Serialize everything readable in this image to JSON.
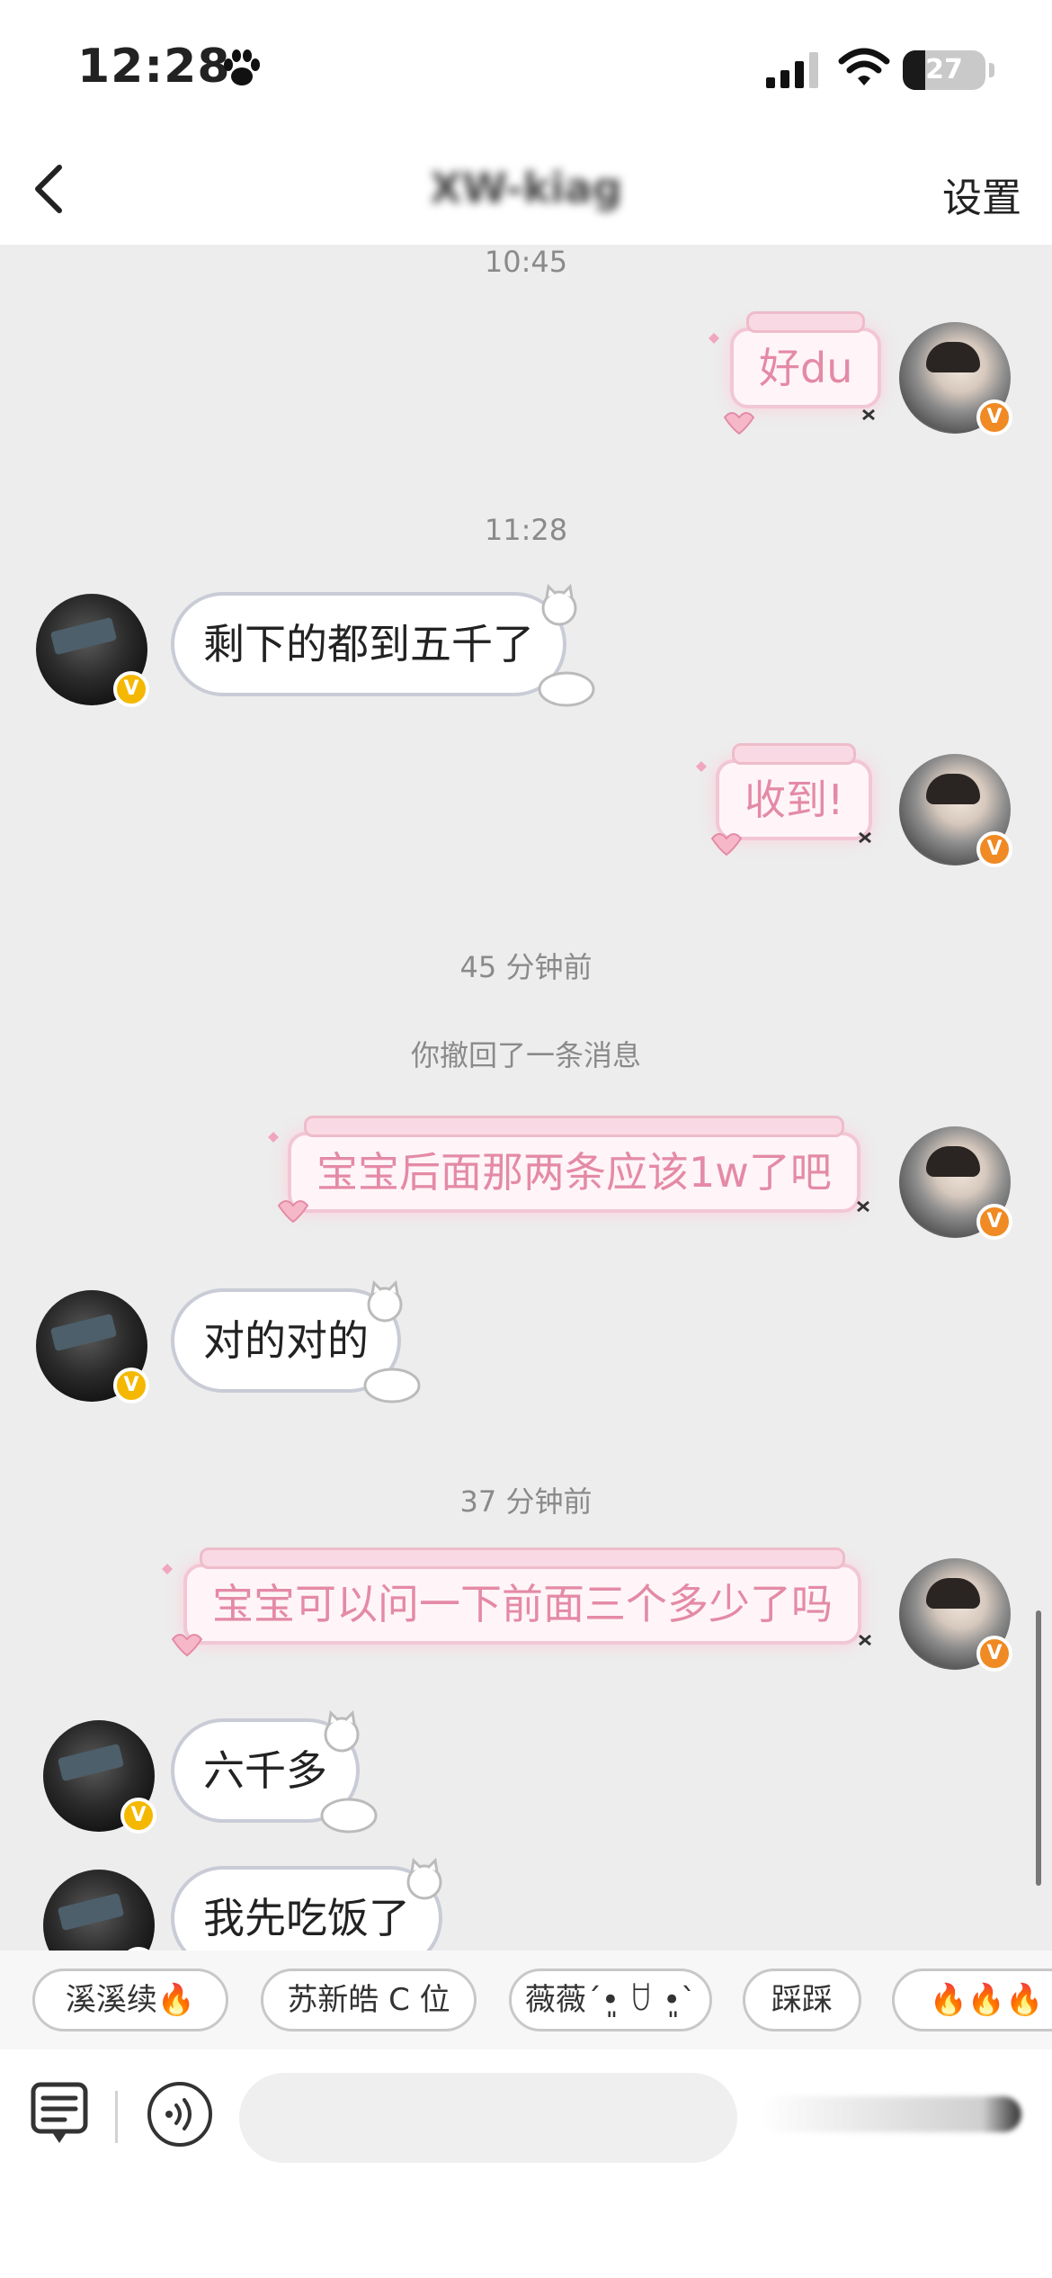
{
  "status_bar": {
    "time": "12:28",
    "battery": "27",
    "battery_level": 0.27
  },
  "nav": {
    "title": "XW-kiag",
    "settings_label": "设置"
  },
  "messages": [
    {
      "type": "timestamp",
      "text": "10:45"
    },
    {
      "type": "sent",
      "text": "好du"
    },
    {
      "type": "timestamp",
      "text": "11:28"
    },
    {
      "type": "received",
      "text": "剩下的都到五千了"
    },
    {
      "type": "sent",
      "text": "收到!"
    },
    {
      "type": "timestamp",
      "text": "45 分钟前"
    },
    {
      "type": "system",
      "text": "你撤回了一条消息"
    },
    {
      "type": "sent",
      "text": "宝宝后面那两条应该1w了吧"
    },
    {
      "type": "received",
      "text": "对的对的"
    },
    {
      "type": "timestamp",
      "text": "37 分钟前"
    },
    {
      "type": "sent",
      "text": "宝宝可以问一下前面三个多少了吗"
    },
    {
      "type": "received",
      "text": "六千多"
    },
    {
      "type": "received",
      "text": "我先吃饭了"
    }
  ],
  "quick_replies": [
    "溪溪续🔥",
    "苏新皓 C 位",
    "薇薇ˊ•͈ ꇴ •͈ˋ",
    "踩踩",
    "🔥🔥🔥"
  ],
  "badges": {
    "verified": "V"
  },
  "colors": {
    "sent_text": "#e48aa6",
    "background": "#ededed",
    "verified_orange": "#f08a24",
    "verified_yellow": "#f5b800"
  },
  "icons": [
    "paw-icon",
    "signal-icon",
    "wifi-icon",
    "back-icon",
    "menu-icon",
    "voice-icon"
  ]
}
